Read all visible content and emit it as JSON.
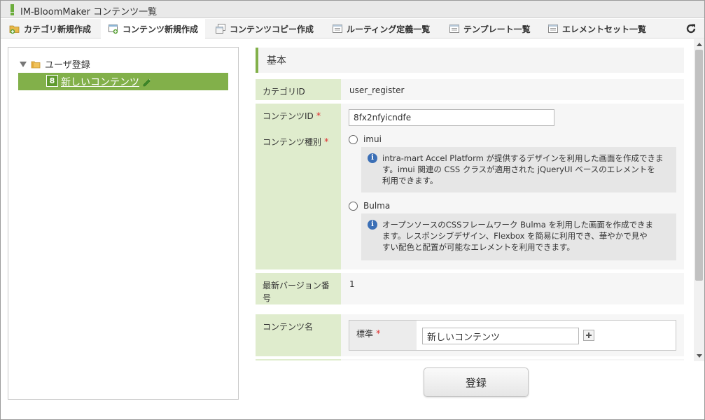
{
  "window": {
    "title": "IM-BloomMaker コンテンツ一覧"
  },
  "toolbar": {
    "items": [
      {
        "label": "カテゴリ新規作成",
        "icon": "folder-add-icon"
      },
      {
        "label": "コンテンツ新規作成",
        "icon": "content-add-icon"
      },
      {
        "label": "コンテンツコピー作成",
        "icon": "copy-icon"
      },
      {
        "label": "ルーティング定義一覧",
        "icon": "list-icon"
      },
      {
        "label": "テンプレート一覧",
        "icon": "list-icon"
      },
      {
        "label": "エレメントセット一覧",
        "icon": "list-icon"
      }
    ],
    "reload_icon": "reload-icon"
  },
  "tree": {
    "root_label": "ユーザ登録",
    "selected": {
      "badge": "8",
      "label": "新しいコンテンツ"
    }
  },
  "section": {
    "title": "基本"
  },
  "form": {
    "category_id": {
      "label": "カテゴリID",
      "value": "user_register"
    },
    "content_id": {
      "label": "コンテンツID",
      "required": "*",
      "value": "8fx2nfyicndfe"
    },
    "content_type": {
      "label": "コンテンツ種別",
      "required": "*",
      "options": [
        {
          "label": "imui",
          "info_lines": [
            "intra-mart Accel Platform が提供するデザインを利用した画面を作成できま",
            "す。imui 関連の CSS クラスが適用された jQueryUI ベースのエレメントを",
            "利用できます。"
          ]
        },
        {
          "label": "Bulma",
          "info_lines": [
            "オープンソースのCSSフレームワーク Bulma を利用した画面を作成できま",
            "ます。レスポンシブデザイン、Flexbox を簡易に利用でき、華やかで見や",
            "すい配色と配置が可能なエレメントを利用できます。"
          ]
        }
      ]
    },
    "latest_version": {
      "label_lines": [
        "最新バージョン番",
        "号"
      ],
      "value": "1"
    },
    "content_name": {
      "label": "コンテンツ名",
      "locale_label": "標準",
      "required": "*",
      "value": "新しいコンテンツ"
    }
  },
  "submit": {
    "label": "登録"
  },
  "colors": {
    "accent_green": "#82b04a",
    "label_bg": "#dfeccd",
    "required_red": "#e03030",
    "info_blue": "#3b6fb6"
  }
}
